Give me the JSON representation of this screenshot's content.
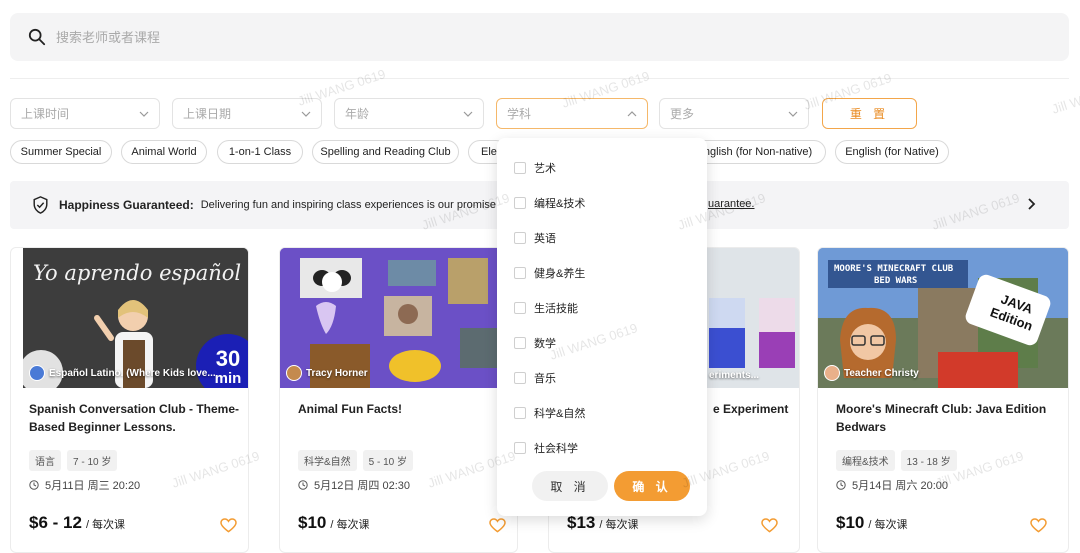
{
  "search": {
    "placeholder": "搜索老师或者课程"
  },
  "filters": [
    {
      "label": "上课时间"
    },
    {
      "label": "上课日期"
    },
    {
      "label": "年龄"
    },
    {
      "label": "学科"
    },
    {
      "label": "更多"
    }
  ],
  "reset_label": "重 置",
  "chips": [
    "Summer Special",
    "Animal World",
    "1-on-1 Class",
    "Spelling and Reading Club",
    "Ele",
    "nglish (for Non-native)",
    "English (for Native)"
  ],
  "banner": {
    "title": "Happiness Guaranteed:",
    "text": "Delivering fun and inspiring class experiences is our promise. Sta",
    "link": "uarantee."
  },
  "cards": [
    {
      "teacher": "Español Latino. (Where Kids love...",
      "title": "Spanish Conversation Club - Theme-Based Beginner Lessons.",
      "tags": [
        "语言",
        "7 - 10 岁"
      ],
      "time": "5月11日 周三 20:20",
      "price": "$6 - 12",
      "per": "/ 每次课",
      "thumb_text": "Yo aprendo español",
      "badge_num": "30",
      "badge_unit": "min"
    },
    {
      "teacher": "Tracy Horner",
      "title": "Animal Fun Facts!",
      "tags": [
        "科学&自然",
        "5 - 10 岁"
      ],
      "time": "5月12日 周四 02:30",
      "price": "$10",
      "per": "/ 每次课"
    },
    {
      "teacher": "eriments...",
      "title": "e Experiment",
      "price": "$13",
      "per": "/ 每次课"
    },
    {
      "teacher": "Teacher Christy",
      "title": "Moore's Minecraft Club: Java Edition Bedwars",
      "tags": [
        "编程&技术",
        "13 - 18 岁"
      ],
      "time": "5月14日 周六 20:00",
      "price": "$10",
      "per": "/ 每次课",
      "thumb_title1": "MOORE'S MINECRAFT CLUB",
      "thumb_title2": "BED WARS",
      "badge": "JAVA Edition"
    }
  ],
  "dropdown": {
    "options": [
      "艺术",
      "编程&技术",
      "英语",
      "健身&养生",
      "生活技能",
      "数学",
      "音乐",
      "科学&自然",
      "社会科学"
    ],
    "cancel": "取 消",
    "confirm": "确 认"
  },
  "watermark": "Jill WANG 0619",
  "colors": {
    "accent": "#f39c33",
    "accent_border": "#f3a64a"
  }
}
